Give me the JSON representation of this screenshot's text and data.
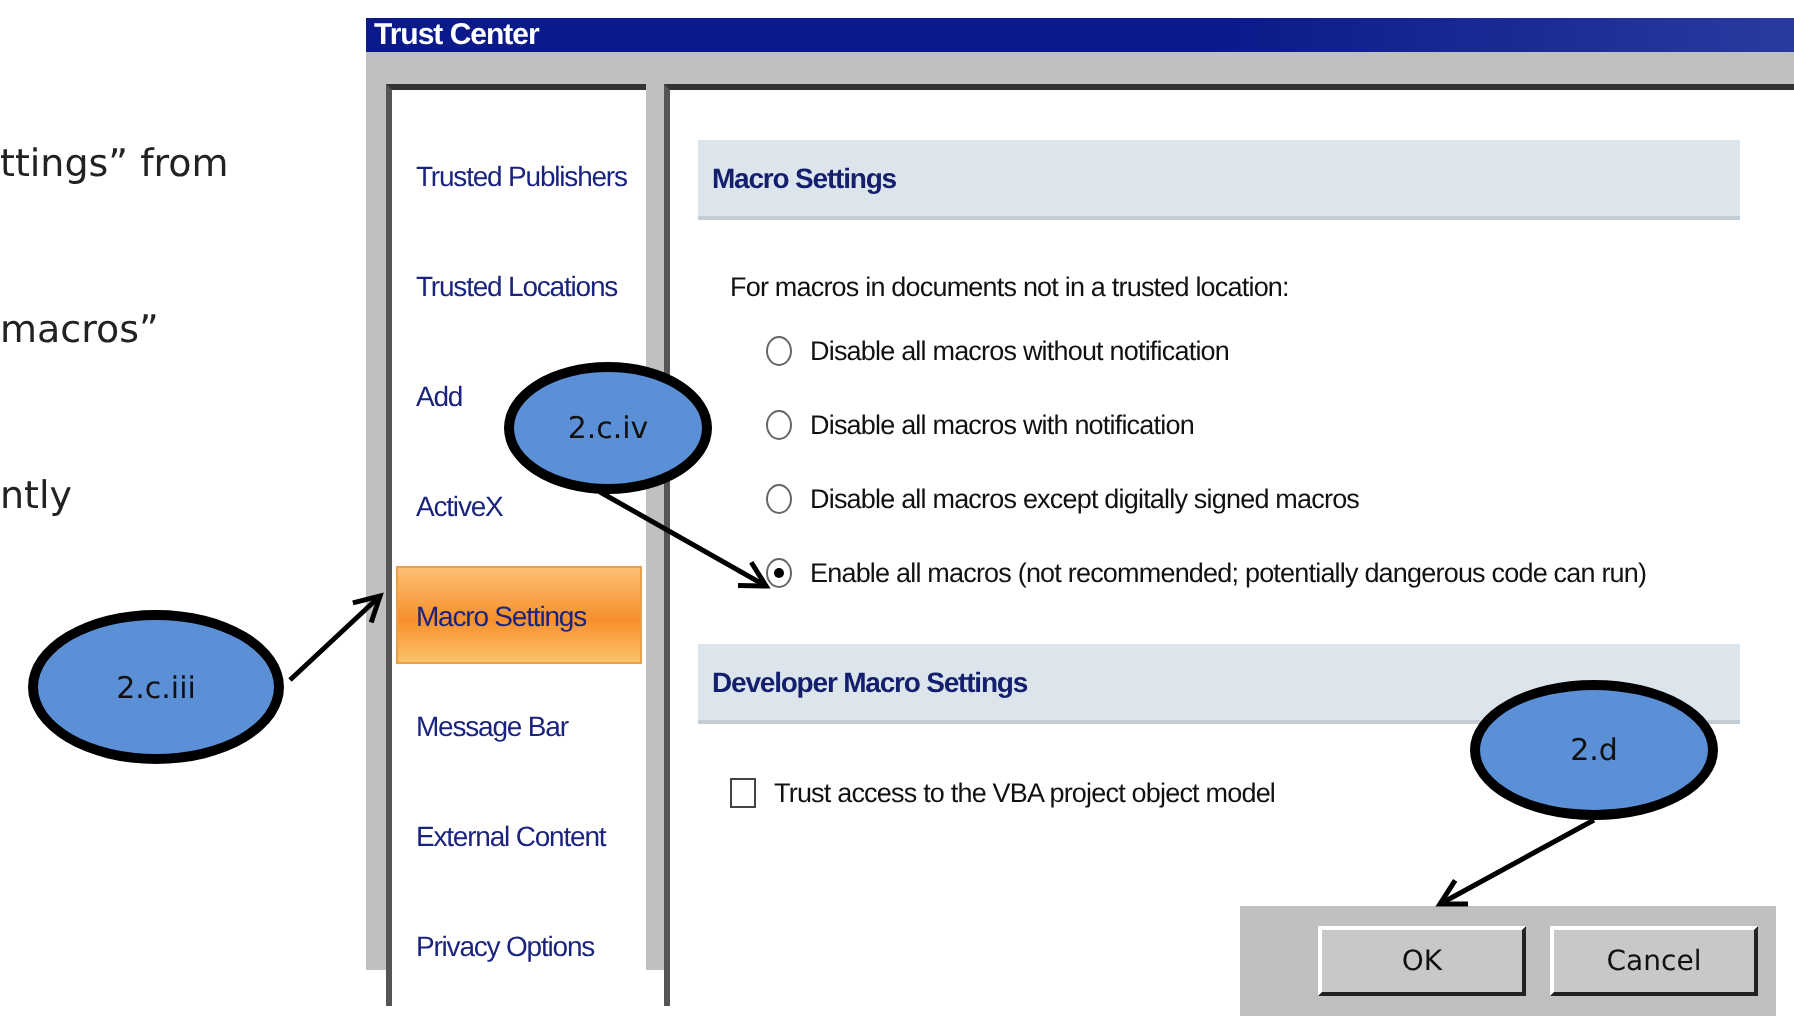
{
  "document_text": [
    "ttings” from",
    "macros”",
    "ntly"
  ],
  "dialog": {
    "title": "Trust Center",
    "nav_items": [
      {
        "label": "Trusted Publishers",
        "selected": false
      },
      {
        "label": "Trusted Locations",
        "selected": false
      },
      {
        "label": "Add",
        "selected": false
      },
      {
        "label": "ActiveX",
        "selected": false
      },
      {
        "label": "Macro Settings",
        "selected": true
      },
      {
        "label": "Message Bar",
        "selected": false
      },
      {
        "label": "External Content",
        "selected": false
      },
      {
        "label": "Privacy Options",
        "selected": false
      }
    ],
    "sections": [
      {
        "title": "Macro Settings",
        "kind": "radio_group",
        "prompt": "For macros in documents not in a trusted location:",
        "options": [
          {
            "label": "Disable all macros without notification",
            "selected": false
          },
          {
            "label": "Disable all macros with notification",
            "selected": false
          },
          {
            "label": "Disable all macros except digitally signed macros",
            "selected": false
          },
          {
            "label": "Enable all macros (not recommended; potentially dangerous code can run)",
            "selected": true
          }
        ]
      },
      {
        "title": "Developer Macro Settings",
        "kind": "checkbox_list",
        "items": [
          {
            "label": "Trust access to the VBA project object model",
            "checked": false
          }
        ]
      }
    ],
    "buttons": [
      "OK",
      "Cancel"
    ]
  },
  "callouts": [
    {
      "label": "2.c.iii"
    },
    {
      "label": "2.c.iv"
    },
    {
      "label": "2.d"
    }
  ]
}
